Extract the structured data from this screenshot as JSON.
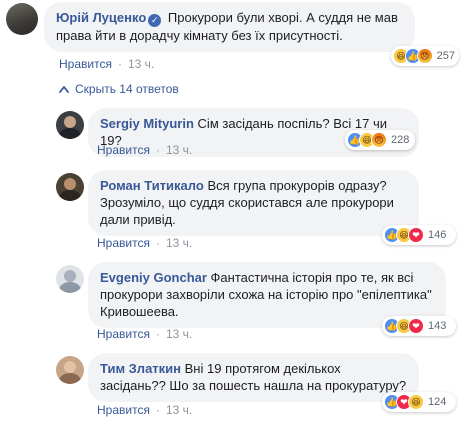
{
  "main_comment": {
    "author": "Юрій Луценко",
    "text": "Прокурори були хворі. А суддя не мав права йти в дорадчу кімнату без їх присутності.",
    "like_label": "Нравится",
    "time": "13 ч.",
    "reaction_count": "257",
    "reactions": [
      "haha-icon",
      "like-icon",
      "angry-icon"
    ]
  },
  "hide_replies_label": "Скрыть 14 ответов",
  "replies": [
    {
      "author": "Sergiy Mityurin",
      "text": "Сім засідань поспіль? Всі 17 чи 19?",
      "like_label": "Нравится",
      "time": "13 ч.",
      "reaction_count": "228",
      "reactions": [
        "like-icon",
        "haha-icon",
        "angry-icon"
      ]
    },
    {
      "author": "Роман Титикало",
      "text": "Вся група прокурорів одразу? Зрозуміло, що суддя скористався але прокурори дали привід.",
      "like_label": "Нравится",
      "time": "13 ч.",
      "reaction_count": "146",
      "reactions": [
        "like-icon",
        "haha-icon",
        "love-icon"
      ]
    },
    {
      "author": "Evgeniy Gonchar",
      "text": "Фантастична історія про те, як всі прокурори захворіли схожа на історію про \"епілептика\" Кривошеева.",
      "like_label": "Нравится",
      "time": "13 ч.",
      "reaction_count": "143",
      "reactions": [
        "like-icon",
        "haha-icon",
        "love-icon"
      ]
    },
    {
      "author": "Тим Златкин",
      "text": "Вні 19 протягом декількох засідань?? Шо за пошесть нашла на прокуратуру?",
      "like_label": "Нравится",
      "time": "13 ч.",
      "reaction_count": "124",
      "reactions": [
        "like-icon",
        "love-icon",
        "haha-icon"
      ]
    }
  ],
  "colors": {
    "link": "#385898",
    "bubble": "#f2f3f5",
    "meta": "#90949c",
    "like": "#4e8ef7",
    "love": "#f0284a",
    "haha": "#f7c945"
  }
}
